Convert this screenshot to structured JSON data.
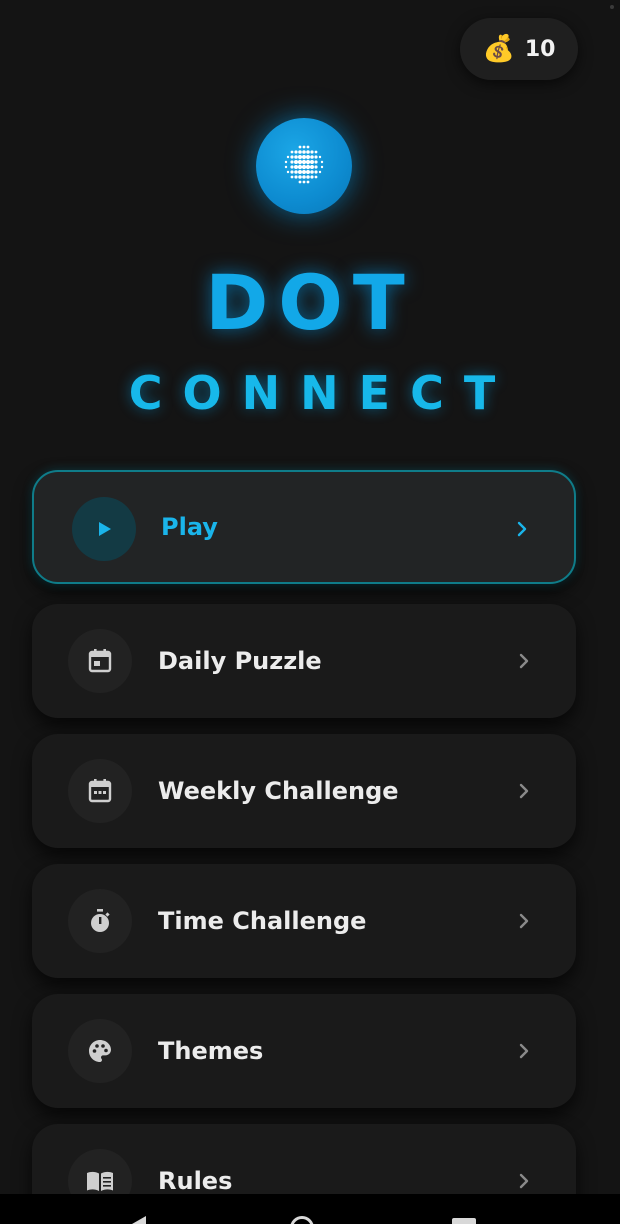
{
  "app": {
    "title_line1": "DOT",
    "title_line2": "CONNECT",
    "accent_color": "#12a8e8",
    "logo_icon": "dot-grid-icon"
  },
  "coins": {
    "icon": "money-bag-icon",
    "icon_glyph": "💰",
    "count": "10"
  },
  "menu": [
    {
      "label": "Play",
      "icon": "play-icon",
      "active": true
    },
    {
      "label": "Daily Puzzle",
      "icon": "calendar-icon",
      "active": false
    },
    {
      "label": "Weekly Challenge",
      "icon": "calendar-week-icon",
      "active": false
    },
    {
      "label": "Time Challenge",
      "icon": "stopwatch-icon",
      "active": false
    },
    {
      "label": "Themes",
      "icon": "palette-icon",
      "active": false
    },
    {
      "label": "Rules",
      "icon": "book-icon",
      "active": false
    }
  ],
  "navigation": {
    "back_icon": "nav-back-icon",
    "home_icon": "nav-home-icon",
    "recent_icon": "nav-recent-icon"
  }
}
